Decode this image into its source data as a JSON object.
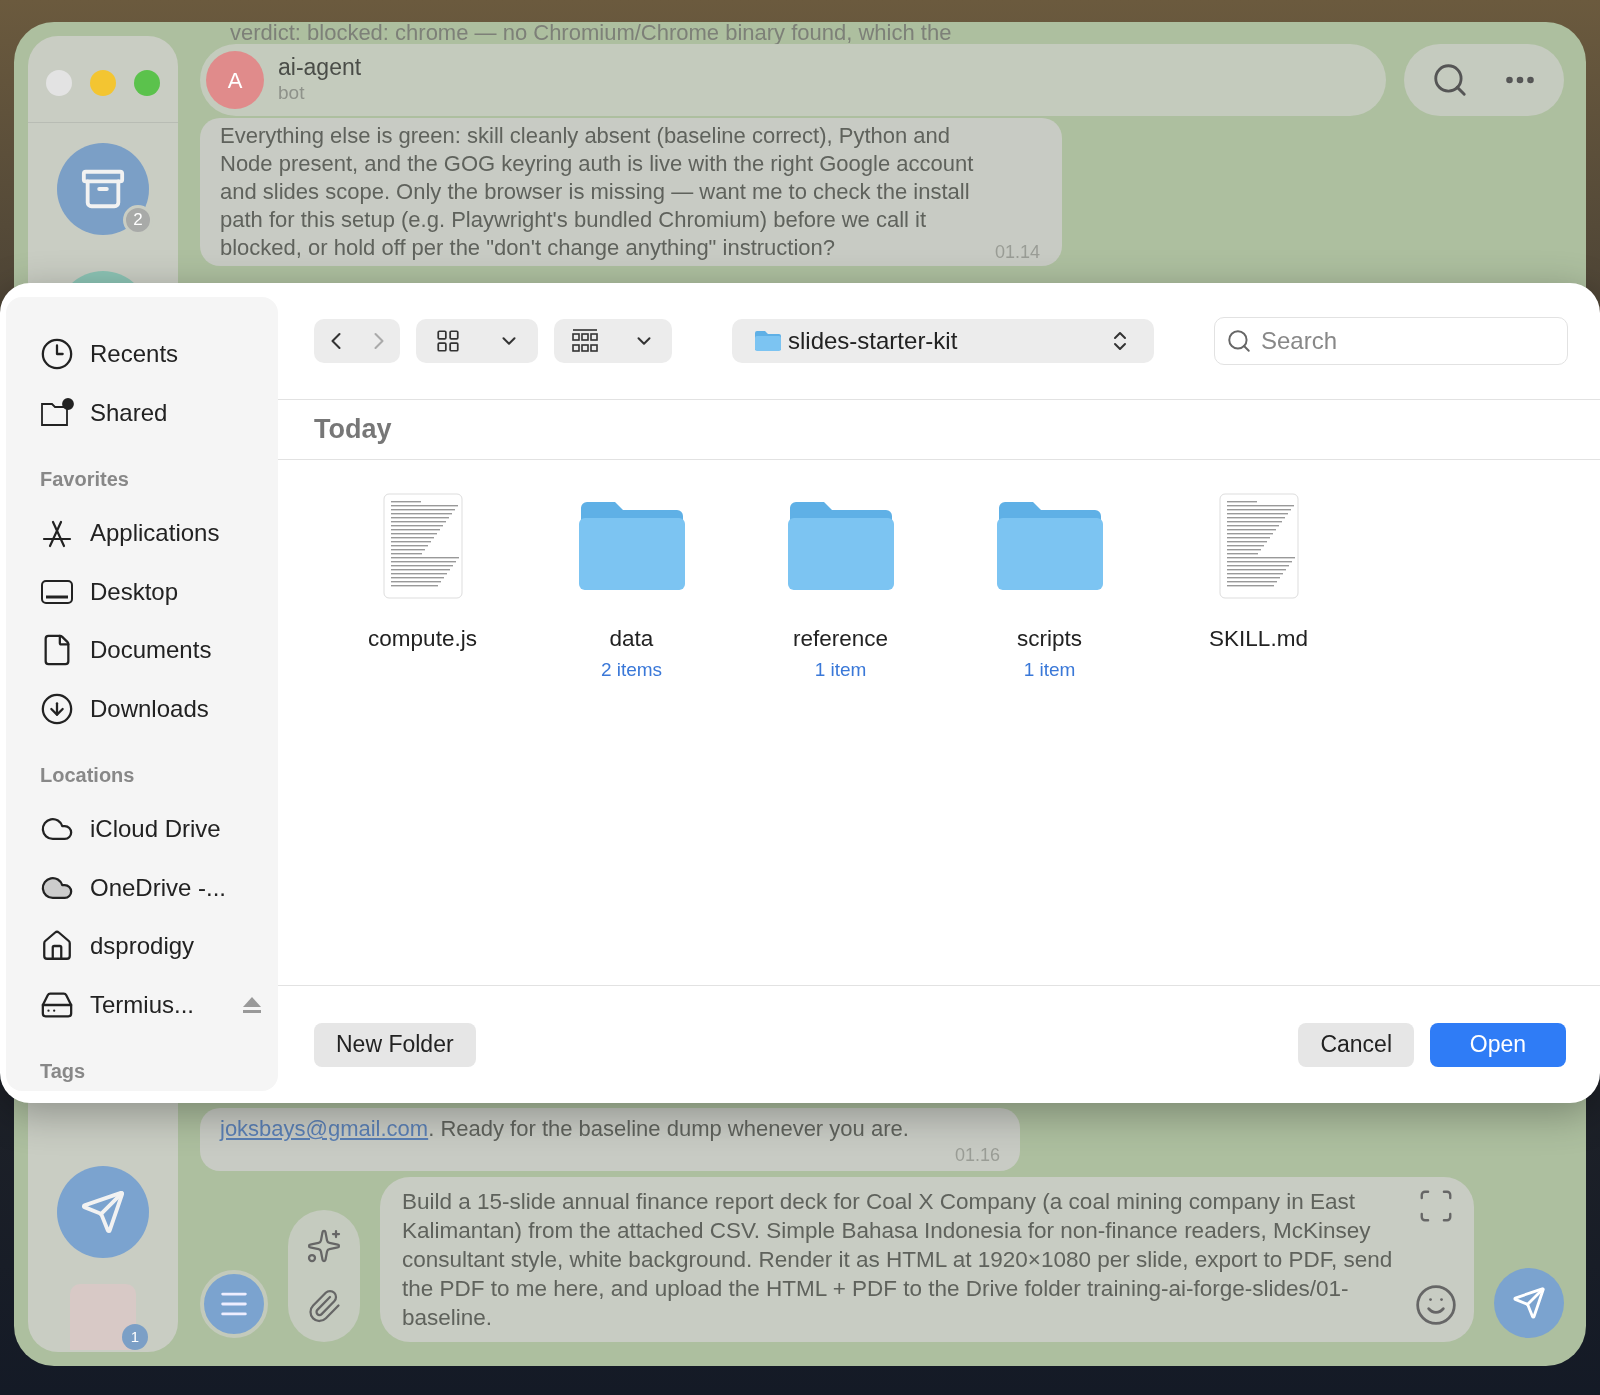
{
  "chat": {
    "peek_text": "verdict: blocked: chrome — no Chromium/Chrome binary found, which the",
    "header": {
      "avatar_letter": "A",
      "name": "ai-agent",
      "status": "bot"
    },
    "message": {
      "text": "Everything else is green: skill cleanly absent (baseline correct), Python and Node present, and the GOG keyring auth is live with the right Google account and slides scope. Only the browser is missing — want me to check the install path for this setup (e.g. Playwright's bundled Chromium) before we call it blocked, or hold off per the \"don't change anything\" instruction?",
      "time": "01.14"
    },
    "lower_message": {
      "link": "joksbays@gmail.com",
      "text": ". Ready for the baseline dump whenever you are.",
      "time": "01.16"
    }
  },
  "rail": {
    "archive_badge": "2",
    "chat_badge": "1"
  },
  "composer": {
    "value": "Build a 15-slide annual finance report deck for Coal X Company (a coal mining company in East Kalimantan) from the attached CSV. Simple Bahasa Indonesia for non-finance readers, McKinsey consultant style, white background. Render it as HTML at 1920×1080 per slide, export to PDF, send the PDF to me here, and upload the HTML + PDF to the Drive folder training-ai-forge-slides/01-baseline."
  },
  "dialog": {
    "sidebar": [
      {
        "items": [
          {
            "kind": "recents",
            "label": "Recents"
          },
          {
            "kind": "shared",
            "label": "Shared"
          }
        ]
      },
      {
        "heading": "Favorites",
        "items": [
          {
            "kind": "applications",
            "label": "Applications"
          },
          {
            "kind": "desktop",
            "label": "Desktop"
          },
          {
            "kind": "documents",
            "label": "Documents"
          },
          {
            "kind": "downloads",
            "label": "Downloads"
          }
        ]
      },
      {
        "heading": "Locations",
        "items": [
          {
            "kind": "icloud",
            "label": "iCloud Drive"
          },
          {
            "kind": "onedrive",
            "label": "OneDrive -..."
          },
          {
            "kind": "home",
            "label": "dsprodigy"
          },
          {
            "kind": "drive",
            "label": "Termius...",
            "ejectable": true
          }
        ]
      },
      {
        "heading": "Tags"
      }
    ],
    "toolbar": {
      "back_disabled": false,
      "forward_disabled": true,
      "location": "slides-starter-kit",
      "search_placeholder": "Search"
    },
    "section": "Today",
    "files": [
      {
        "kind": "document",
        "name": "compute.js"
      },
      {
        "kind": "folder",
        "name": "data",
        "count": "2 items"
      },
      {
        "kind": "folder",
        "name": "reference",
        "count": "1 item"
      },
      {
        "kind": "folder",
        "name": "scripts",
        "count": "1 item"
      },
      {
        "kind": "document",
        "name": "SKILL.md"
      }
    ],
    "left_buttons": [
      {
        "label": "New Folder",
        "kind": "secondary"
      }
    ],
    "right_buttons": [
      {
        "label": "Cancel",
        "kind": "secondary"
      },
      {
        "label": "Open",
        "kind": "primary"
      }
    ]
  }
}
